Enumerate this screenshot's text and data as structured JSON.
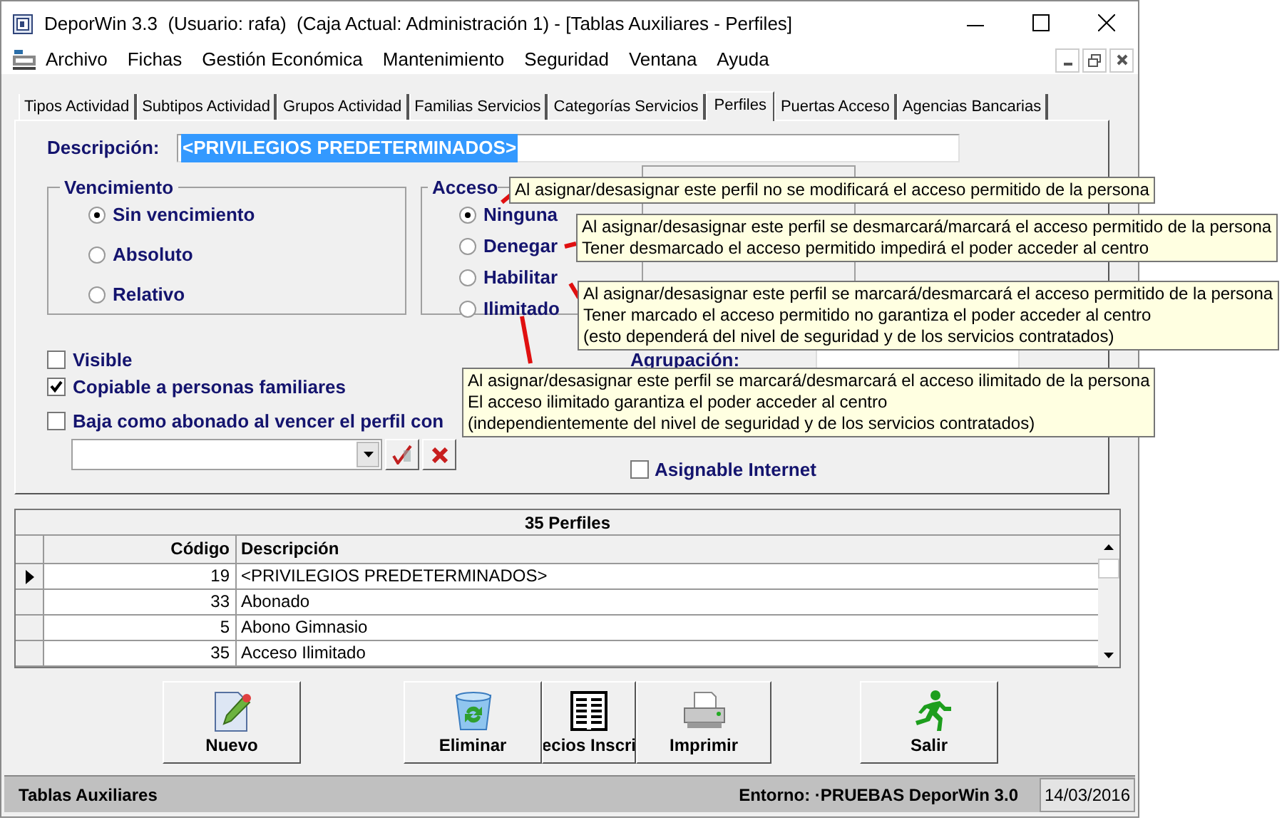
{
  "window": {
    "title": "DeporWin 3.3  (Usuario: rafa)  (Caja Actual: Administración 1) - [Tablas Auxiliares - Perfiles]"
  },
  "menu": {
    "items": [
      "Archivo",
      "Fichas",
      "Gestión Económica",
      "Mantenimiento",
      "Seguridad",
      "Ventana",
      "Ayuda"
    ]
  },
  "tabs": [
    {
      "label": "Tipos Actividad",
      "selected": false
    },
    {
      "label": "Subtipos Actividad",
      "selected": false
    },
    {
      "label": "Grupos Actividad",
      "selected": false
    },
    {
      "label": "Familias Servicios",
      "selected": false
    },
    {
      "label": "Categorías Servicios",
      "selected": false
    },
    {
      "label": "Perfiles",
      "selected": true
    },
    {
      "label": "Puertas Acceso",
      "selected": false
    },
    {
      "label": "Agencias Bancarias",
      "selected": false
    }
  ],
  "description": {
    "label": "Descripción:",
    "value": "<PRIVILEGIOS PREDETERMINADOS>",
    "highlighted": true
  },
  "vencimiento": {
    "title": "Vencimiento",
    "options": [
      {
        "label": "Sin vencimiento",
        "selected": true
      },
      {
        "label": "Absoluto",
        "selected": false
      },
      {
        "label": "Relativo",
        "selected": false
      }
    ]
  },
  "acceso": {
    "title": "Acceso",
    "options": [
      {
        "label": "Ninguna",
        "selected": true
      },
      {
        "label": "Denegar",
        "selected": false
      },
      {
        "label": "Habilitar",
        "selected": false
      },
      {
        "label": "Ilimitado",
        "selected": false
      }
    ]
  },
  "checkboxes": [
    {
      "label": "Visible",
      "checked": false
    },
    {
      "label": "Copiable a personas familiares",
      "checked": true
    },
    {
      "label": "Baja como abonado al vencer el perfil con",
      "checked": false
    }
  ],
  "agrupacion": {
    "label": "Agrupación:"
  },
  "asignable_internet": {
    "label": "Asignable Internet",
    "checked": false
  },
  "grid": {
    "title": "35 Perfiles",
    "columns": [
      "Código",
      "Descripción"
    ],
    "rows": [
      {
        "cells": [
          "19",
          "<PRIVILEGIOS PREDETERMINADOS>"
        ],
        "selected": true
      },
      {
        "cells": [
          "33",
          "Abonado"
        ],
        "selected": false
      },
      {
        "cells": [
          "5",
          "Abono Gimnasio"
        ],
        "selected": false
      },
      {
        "cells": [
          "35",
          "Acceso Ilimitado"
        ],
        "selected": false
      }
    ]
  },
  "buttons": [
    {
      "label": "Nuevo",
      "kind": "new"
    },
    {
      "label": "Eliminar",
      "kind": "delete"
    },
    {
      "label": "ecios Inscri",
      "kind": "list"
    },
    {
      "label": "Imprimir",
      "kind": "print"
    },
    {
      "label": "Salir",
      "kind": "exit"
    }
  ],
  "status_bar": {
    "section": "Tablas Auxiliares",
    "environment": "Entorno: ·PRUEBAS DeporWin 3.0",
    "date": "14/03/2016"
  },
  "tooltips": [
    {
      "lines": [
        "Al asignar/desasignar este perfil no se modificará el acceso permitido de la persona"
      ]
    },
    {
      "lines": [
        "Al asignar/desasignar este perfil se desmarcará/marcará el acceso permitido de la persona",
        "Tener desmarcado el acceso permitido impedirá el poder acceder al centro"
      ]
    },
    {
      "lines": [
        "Al asignar/desasignar este perfil se marcará/desmarcará el acceso permitido de la persona",
        "Tener marcado el acceso permitido no garantiza el poder acceder al centro",
        "(esto dependerá del nivel de seguridad y de los servicios contratados)"
      ]
    },
    {
      "lines": [
        "Al asignar/desasignar este perfil se marcará/desmarcará el acceso ilimitado de la persona",
        "El acceso ilimitado garantiza el poder acceder al centro",
        "(independientemente del nivel de seguridad y de los servicios contratados)"
      ]
    }
  ]
}
